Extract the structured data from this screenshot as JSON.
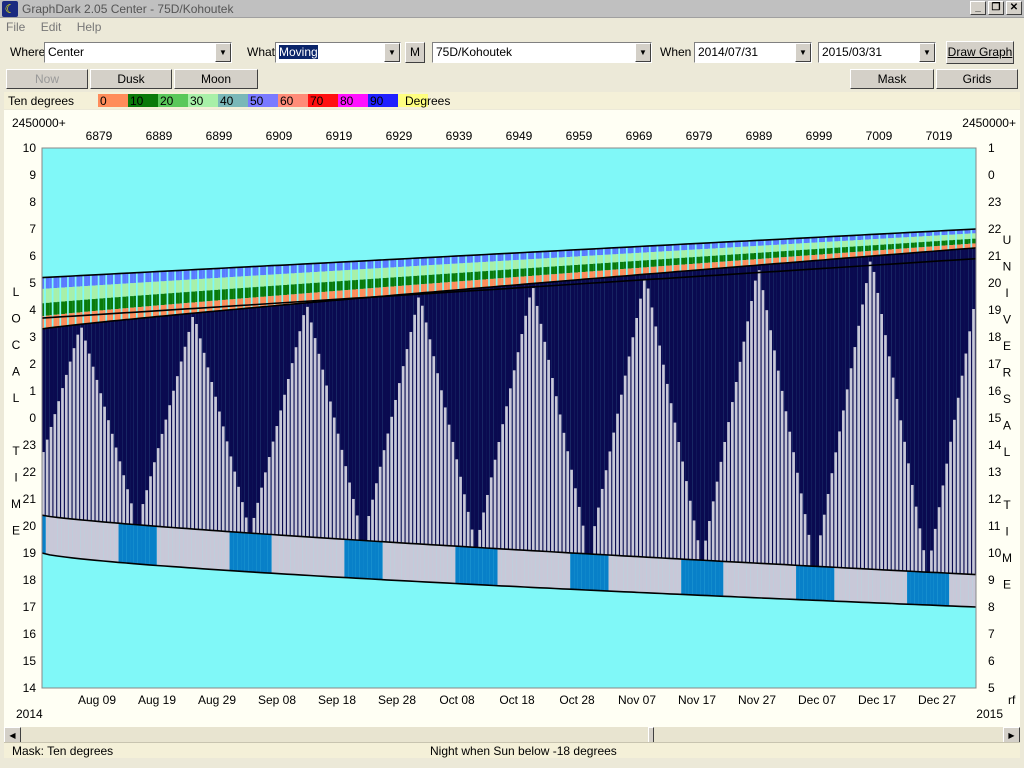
{
  "window": {
    "title": "GraphDark 2.05  Center  -  75D/Kohoutek",
    "controls": [
      "_",
      "❐",
      "✕"
    ]
  },
  "menu": [
    "File",
    "Edit",
    "Help"
  ],
  "toolbar": {
    "where_label": "Where",
    "where_value": "Center",
    "what_label": "What",
    "what_value": "Moving",
    "m_button": "M",
    "object_value": "75D/Kohoutek",
    "when_label": "When",
    "start_date": "2014/07/31",
    "end_date": "2015/03/31",
    "draw_button": "Draw Graph"
  },
  "toolbar2": {
    "now": "Now",
    "dusk": "Dusk",
    "moon": "Moon",
    "mask": "Mask",
    "grids": "Grids"
  },
  "legend": {
    "label": "Ten degrees",
    "suffix": "Degrees",
    "bins": [
      {
        "text": "0",
        "color": "#ff8c5a"
      },
      {
        "text": "10",
        "color": "#0a7a0a"
      },
      {
        "text": "20",
        "color": "#5ac85a"
      },
      {
        "text": "30",
        "color": "#a8f0a8"
      },
      {
        "text": "40",
        "color": "#7ab8b8"
      },
      {
        "text": "50",
        "color": "#7a7aff"
      },
      {
        "text": "60",
        "color": "#ff8c78"
      },
      {
        "text": "70",
        "color": "#ff1010"
      },
      {
        "text": "80",
        "color": "#ff10ff"
      },
      {
        "text": "90",
        "color": "#2020ff"
      },
      {
        "text": "",
        "color": "#ffff80"
      }
    ]
  },
  "graph": {
    "jd_prefix_left": "2450000+",
    "jd_prefix_right": "2450000+",
    "jd_ticks": [
      "6879",
      "6889",
      "6899",
      "6909",
      "6919",
      "6929",
      "6939",
      "6949",
      "6959",
      "6969",
      "6979",
      "6989",
      "6999",
      "7009",
      "7019"
    ],
    "left_axis": [
      "10",
      "9",
      "8",
      "7",
      "6",
      "5",
      "4",
      "3",
      "2",
      "1",
      "0",
      "23",
      "22",
      "21",
      "20",
      "19",
      "18",
      "17",
      "16",
      "15",
      "14"
    ],
    "right_axis": [
      "1",
      "0",
      "23",
      "22",
      "21",
      "20",
      "19",
      "18",
      "17",
      "16",
      "15",
      "14",
      "13",
      "12",
      "11",
      "10",
      "9",
      "8",
      "7",
      "6",
      "5"
    ],
    "left_title": [
      "L",
      "O",
      "C",
      "A",
      "L",
      "",
      "T",
      "I",
      "M",
      "E"
    ],
    "right_title": [
      "U",
      "N",
      "I",
      "V",
      "E",
      "R",
      "S",
      "A",
      "L",
      "",
      "T",
      "I",
      "M",
      "E"
    ],
    "date_ticks": [
      "Aug 09",
      "Aug 19",
      "Aug 29",
      "Sep 08",
      "Sep 18",
      "Sep 28",
      "Oct 08",
      "Oct 18",
      "Oct 28",
      "Nov 07",
      "Nov 17",
      "Nov 27",
      "Dec 07",
      "Dec 17",
      "Dec 27"
    ],
    "year_left": "2014",
    "year_right": "2015",
    "corner_right": "rf",
    "colors": {
      "sky_day": "#80f8f8",
      "night": "#0a0a50",
      "twilight": "#0880c8",
      "moonlit": "#c8c8d8"
    }
  },
  "status": {
    "mask": "Mask:  Ten degrees",
    "night": "Night when Sun below -18 degrees"
  }
}
